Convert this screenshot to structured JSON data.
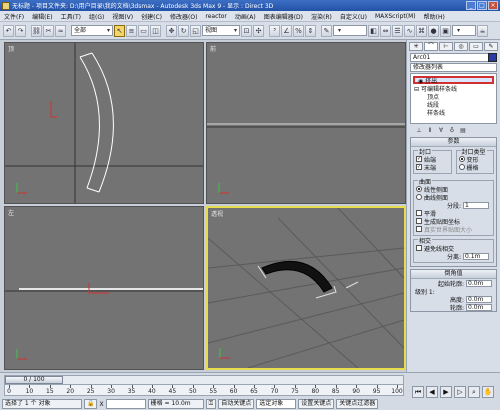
{
  "app": {
    "title": "无标题 - 项目文件夹: D:\\用户目录\\我的文档\\3dsmax - Autodesk 3ds Max 9 - 显示 : Direct 3D",
    "window_buttons": [
      "_",
      "□",
      "×"
    ]
  },
  "menu": [
    "文件(F)",
    "编辑(E)",
    "工具(T)",
    "组(G)",
    "视图(V)",
    "创建(C)",
    "修改器(O)",
    "reactor",
    "动画(A)",
    "图表编辑器(D)",
    "渲染(R)",
    "自定义(U)",
    "MAXScript(M)",
    "帮助(H)"
  ],
  "toolbar": {
    "filter_select": "全部",
    "coord_select": "视图"
  },
  "viewports": {
    "top": "顶",
    "front": "前",
    "left": "左",
    "perspective": "透视"
  },
  "command_panel": {
    "object_name": "Arc01",
    "object_color": "#2b3aa0",
    "modifier_list": "修改器列表",
    "stack": {
      "selected": "挤出",
      "edit_spline": "可编辑样条线",
      "sub_vertex": "顶点",
      "sub_segment": "线段",
      "sub_spline": "样条线"
    },
    "params_title": "参数",
    "cap": {
      "label": "封口",
      "start": "始端",
      "end": "末端"
    },
    "cap_type": {
      "label": "封口类型",
      "morph": "变形",
      "grid": "栅格"
    },
    "surface": {
      "label": "曲面",
      "linear": "线性侧面",
      "curved": "曲线侧面",
      "segments_label": "分段:",
      "segments_value": "1",
      "smooth": "平滑",
      "gen_mapping": "生成贴图坐标",
      "real_world": "真实世界贴图大小"
    },
    "corners": {
      "label": "相交",
      "avoid": "避免线相交",
      "separation_label": "分离:",
      "separation_value": "0.1m"
    },
    "bevel": {
      "title": "倒角值",
      "start_outline_label": "起始轮廓:",
      "start_outline_value": "0.0m",
      "level1": "级别 1:",
      "height_label": "高度:",
      "height_value": "0.0m",
      "outline_label": "轮廓:",
      "outline_value": "0.0m"
    }
  },
  "timeline": {
    "slider_label": "0 / 100",
    "ticks": [
      "0",
      "10",
      "15",
      "20",
      "25",
      "30",
      "35",
      "40",
      "45",
      "50",
      "55",
      "60",
      "65",
      "70",
      "75",
      "80",
      "85",
      "90",
      "95",
      "100"
    ]
  },
  "statusbar": {
    "selected": "选择了 1 个 对象",
    "x_label": "X",
    "x_value": "",
    "grid": "栅格 = 10.0m",
    "autokey": "自动关键点",
    "selected_obj": "选定对象",
    "setkey": "设置关键点",
    "keyfilter": "关键点过滤器"
  }
}
